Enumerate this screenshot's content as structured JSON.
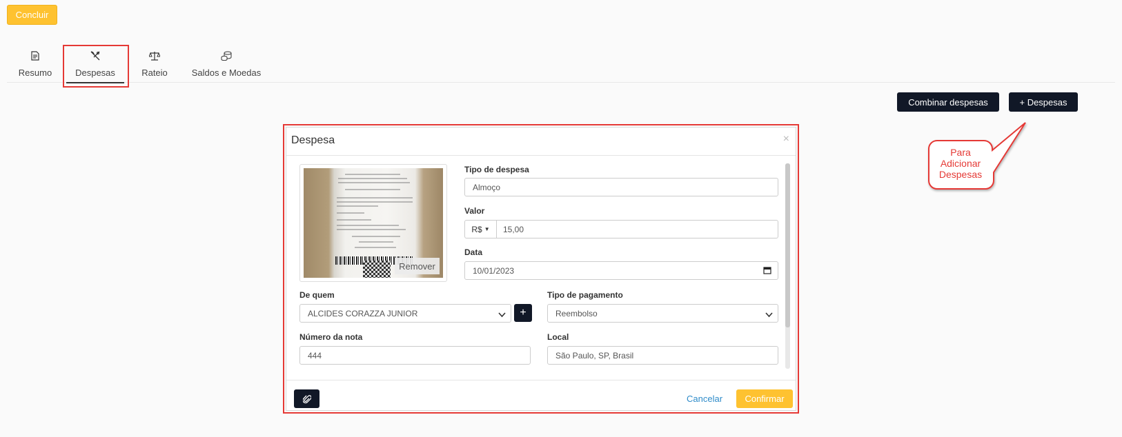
{
  "toolbar": {
    "concluir_label": "Concluir"
  },
  "tabs": [
    {
      "label": "Resumo",
      "icon": "document-icon"
    },
    {
      "label": "Despesas",
      "icon": "cutlery-icon"
    },
    {
      "label": "Rateio",
      "icon": "scale-icon"
    },
    {
      "label": "Saldos e Moedas",
      "icon": "coins-icon"
    }
  ],
  "actions": {
    "combinar_label": "Combinar despesas",
    "add_despesas_label": "+ Despesas"
  },
  "callout": {
    "line1": "Para",
    "line2": "Adicionar",
    "line3": "Despesas"
  },
  "modal": {
    "title": "Despesa",
    "close": "×",
    "receipt": {
      "remover_label": "Remover"
    },
    "tipo_despesa": {
      "label": "Tipo de despesa",
      "value": "Almoço"
    },
    "valor": {
      "label": "Valor",
      "currency": "R$",
      "value": "15,00"
    },
    "data": {
      "label": "Data",
      "value": "10/01/2023"
    },
    "de_quem": {
      "label": "De quem",
      "value": "ALCIDES CORAZZA JUNIOR",
      "add": "+"
    },
    "tipo_pagamento": {
      "label": "Tipo de pagamento",
      "value": "Reembolso"
    },
    "numero_nota": {
      "label": "Número da nota",
      "value": "444"
    },
    "local": {
      "label": "Local",
      "value": "São Paulo, SP, Brasil"
    },
    "footer": {
      "cancelar_label": "Cancelar",
      "confirmar_label": "Confirmar"
    }
  },
  "colors": {
    "accent": "#fec230",
    "dark": "#111827",
    "annotation": "#e53935",
    "link": "#2e8bc9"
  }
}
